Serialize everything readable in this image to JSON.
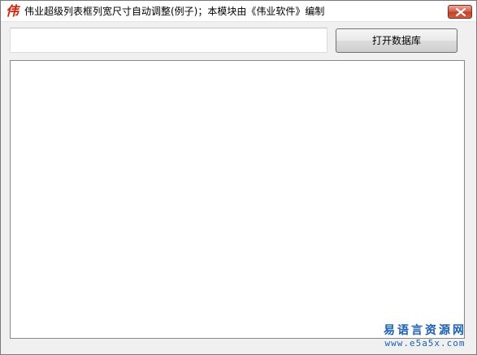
{
  "window": {
    "title": "伟业超级列表框列宽尺寸自动调整(例子)；本模块由《伟业软件》编制",
    "icon_glyph": "伟",
    "icon_name": "app-logo-icon",
    "close_icon": "close-icon"
  },
  "form": {
    "path_input_value": "",
    "open_db_label": "打开数据库"
  },
  "listview": {
    "items": []
  },
  "watermark": {
    "site_name": "易语言资源网",
    "site_url": "www.e5a5x.com"
  },
  "colors": {
    "icon_red": "#d81e06",
    "close_red": "#c2412a",
    "watermark_blue": "#1a5fb4"
  }
}
